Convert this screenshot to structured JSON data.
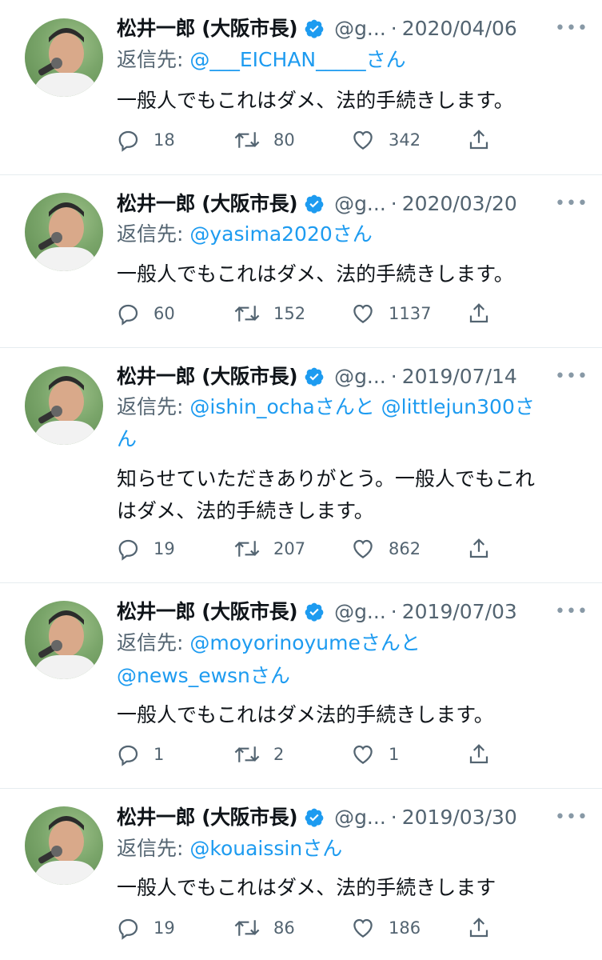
{
  "tweets": [
    {
      "name": "松井一郎 (大阪市長)",
      "handle": "@g...",
      "date": "2020/04/06",
      "reply_prefix": "返信先:",
      "reply_targets": "@___EICHAN_____",
      "reply_suffix": "さん",
      "reply_line2": "",
      "text_line1": "一般人でもこれはダメ、法的手続きします。",
      "text_line2": "",
      "replies": "18",
      "retweets": "80",
      "likes": "342"
    },
    {
      "name": "松井一郎 (大阪市長)",
      "handle": "@g...",
      "date": "2020/03/20",
      "reply_prefix": "返信先:",
      "reply_targets": "@yasima2020",
      "reply_suffix": "さん",
      "reply_line2": "",
      "text_line1": "一般人でもこれはダメ、法的手続きします。",
      "text_line2": "",
      "replies": "60",
      "retweets": "152",
      "likes": "1137"
    },
    {
      "name": "松井一郎 (大阪市長)",
      "handle": "@g...",
      "date": "2019/07/14",
      "reply_prefix": "返信先:",
      "reply_targets": "@ishin_ocha",
      "reply_suffix": "さんと",
      "reply_target2": "@littlejun300",
      "reply_suffix2": "さ",
      "reply_line2": "ん",
      "text_line1": "知らせていただきありがとう。一般人でもこれ",
      "text_line2": "はダメ、法的手続きします。",
      "replies": "19",
      "retweets": "207",
      "likes": "862"
    },
    {
      "name": "松井一郎 (大阪市長)",
      "handle": "@g...",
      "date": "2019/07/03",
      "reply_prefix": "返信先:",
      "reply_targets": "@moyorinoyume",
      "reply_suffix": "さんと",
      "reply_line2_mention": "@news_ewsn",
      "reply_line2": "さん",
      "text_line1": "一般人でもこれはダメ法的手続きします。",
      "text_line2": "",
      "replies": "1",
      "retweets": "2",
      "likes": "1"
    },
    {
      "name": "松井一郎 (大阪市長)",
      "handle": "@g...",
      "date": "2019/03/30",
      "reply_prefix": "返信先:",
      "reply_targets": "@kouaissin",
      "reply_suffix": "さん",
      "reply_line2": "",
      "text_line1": "一般人でもこれはダメ、法的手続きします",
      "text_line2": "",
      "replies": "19",
      "retweets": "86",
      "likes": "186"
    }
  ],
  "icons": {
    "verified": "verified-badge-icon",
    "more": "more-options-icon",
    "reply": "reply-icon",
    "retweet": "retweet-icon",
    "like": "like-icon",
    "share": "share-icon"
  },
  "colors": {
    "accent": "#1d9bf0",
    "muted": "#536471",
    "divider": "#e6ecf0"
  }
}
